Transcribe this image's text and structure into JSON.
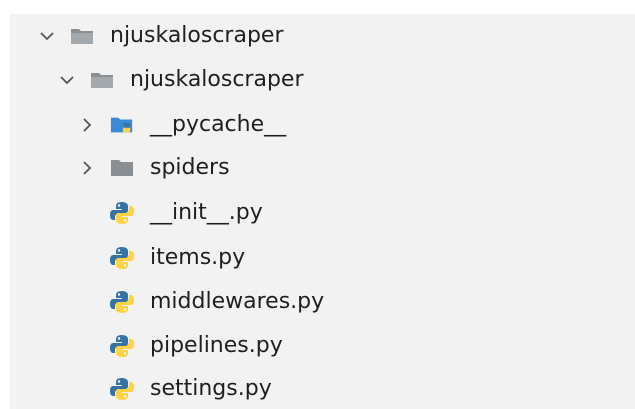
{
  "tree": {
    "items": [
      {
        "label": "njuskaloscraper",
        "icon": "folder-open-icon",
        "expanded": true,
        "depth": 0
      },
      {
        "label": "njuskaloscraper",
        "icon": "folder-open-icon",
        "expanded": true,
        "depth": 1
      },
      {
        "label": "__pycache__",
        "icon": "python-folder-icon",
        "expanded": false,
        "depth": 2
      },
      {
        "label": "spiders",
        "icon": "folder-icon",
        "expanded": false,
        "depth": 2
      },
      {
        "label": "__init__.py",
        "icon": "python-file-icon",
        "depth": 2
      },
      {
        "label": "items.py",
        "icon": "python-file-icon",
        "depth": 2
      },
      {
        "label": "middlewares.py",
        "icon": "python-file-icon",
        "depth": 2
      },
      {
        "label": "pipelines.py",
        "icon": "python-file-icon",
        "depth": 2
      },
      {
        "label": "settings.py",
        "icon": "python-file-icon",
        "depth": 2
      }
    ]
  },
  "colors": {
    "panel_bg": "#f2f2f2",
    "folder": "#8a8f94",
    "python_blue": "#3673a5",
    "python_yellow": "#ffd343",
    "folder_blue": "#3c8ad8",
    "chevron": "#555555",
    "text": "#1f1f1f"
  }
}
